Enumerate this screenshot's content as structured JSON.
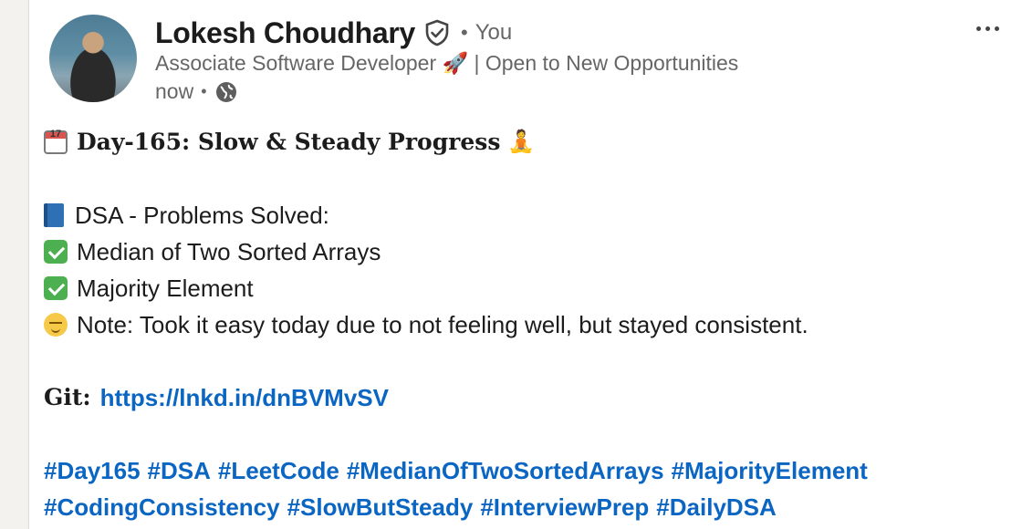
{
  "post": {
    "author": {
      "name": "Lokesh Choudhary",
      "relation": "You",
      "headline": "Associate Software Developer 🚀 | Open to New Opportunities",
      "time": "now"
    },
    "title_prefix": "Day-165",
    "title_rest": ": Slow & Steady Progress",
    "dsa_heading": "DSA - Problems Solved:",
    "problems": [
      "Median of Two Sorted Arrays",
      "Majority Element"
    ],
    "note": "Note: Took it easy today due to not feeling well, but stayed consistent.",
    "git_label": "Git",
    "git_colon": ":",
    "git_link": "https://lnkd.in/dnBVMvSV",
    "hashtags_line1": [
      "#Day165",
      "#DSA",
      "#LeetCode",
      "#MedianOfTwoSortedArrays",
      "#MajorityElement"
    ],
    "hashtags_line2": [
      "#CodingConsistency",
      "#SlowButSteady",
      "#InterviewPrep",
      "#DailyDSA"
    ]
  },
  "icons": {
    "verified": "verified-shield-icon",
    "globe": "globe-icon",
    "more": "more-options-icon",
    "calendar": "calendar-icon",
    "book": "book-icon",
    "check": "check-mark-icon",
    "relieved": "relieved-face-icon",
    "meditation": "meditation-icon"
  },
  "colors": {
    "link": "#0a66c2",
    "muted": "#666666",
    "text": "#1c1c1c"
  }
}
